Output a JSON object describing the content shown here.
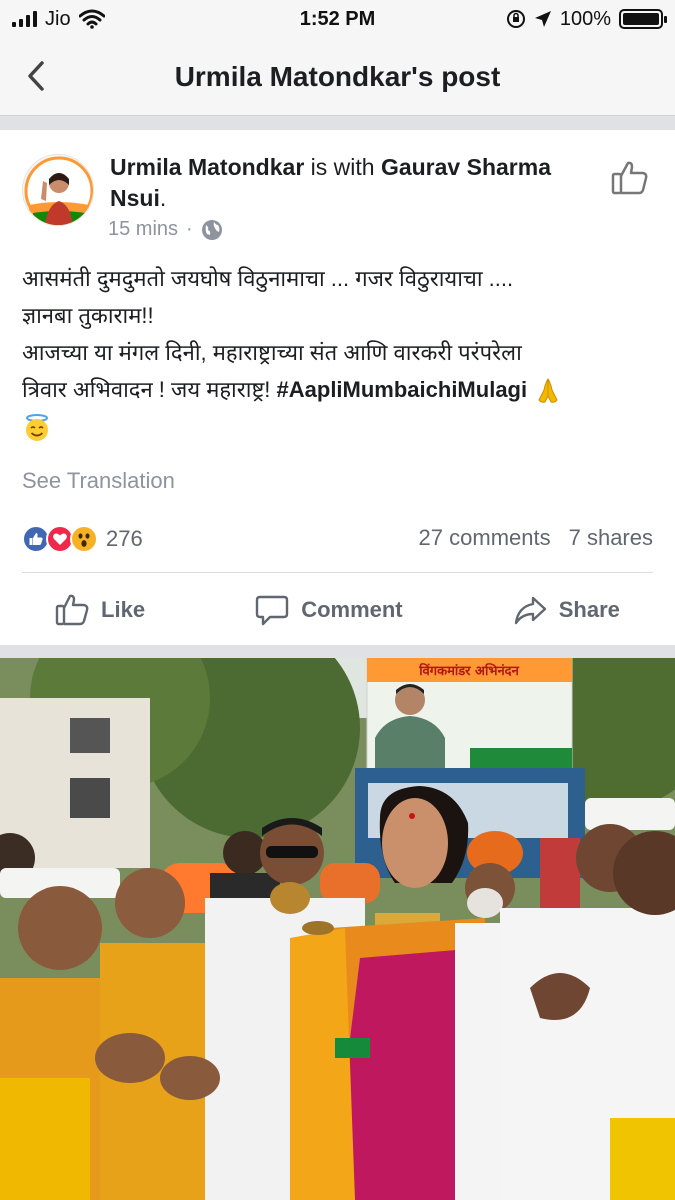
{
  "status_bar": {
    "carrier": "Jio",
    "time": "1:52 PM",
    "battery": "100%",
    "battery_level": 1.0
  },
  "nav": {
    "title": "Urmila Matondkar's post"
  },
  "post": {
    "author": "Urmila Matondkar",
    "with_text": " is with ",
    "tagged": "Gaurav Sharma Nsui",
    "period": ".",
    "time": "15 mins",
    "lines": [
      "आसमंती दुमदुमतो जयघोष विठुनामाचा ...  गजर विठुरायाचा ....",
      "ज्ञानबा तुकाराम!!",
      "आजच्या या मंगल दिनी, महाराष्ट्राच्या संत आणि वारकरी परंपरेला",
      "त्रिवार अभिवादन ! जय महाराष्ट्र! "
    ],
    "hashtag": "#AapliMumbaichiMulagi",
    "see_translation": "See Translation",
    "reaction_count": "276",
    "comments": "27 comments",
    "shares": "7 shares"
  },
  "actions": {
    "like": "Like",
    "comment": "Comment",
    "share": "Share"
  },
  "photo": {
    "banner_title": "विंगकमांडर अभिनंदन"
  },
  "icons": {
    "back": "chevron-left-icon",
    "globe": "globe-icon",
    "thumb": "thumbs-up-icon",
    "love": "heart-icon",
    "wow": "wow-icon"
  },
  "colors": {
    "fb_blue": "#4267b2",
    "love_red": "#f0284a",
    "wow_yellow": "#f7b125",
    "secondary_text": "#606770",
    "muted_text": "#8d949e"
  }
}
